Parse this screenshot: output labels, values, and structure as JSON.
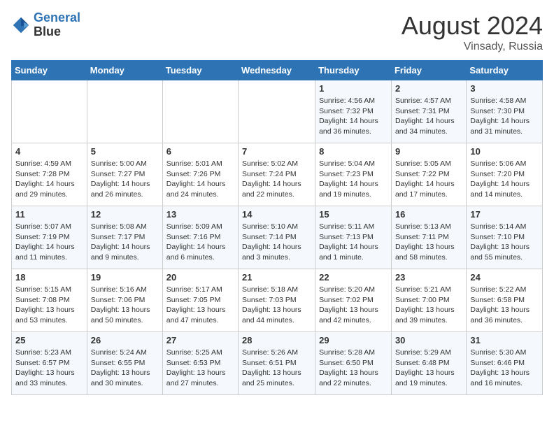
{
  "header": {
    "logo_line1": "General",
    "logo_line2": "Blue",
    "month_title": "August 2024",
    "location": "Vinsady, Russia"
  },
  "weekdays": [
    "Sunday",
    "Monday",
    "Tuesday",
    "Wednesday",
    "Thursday",
    "Friday",
    "Saturday"
  ],
  "weeks": [
    [
      {
        "day": "",
        "info": ""
      },
      {
        "day": "",
        "info": ""
      },
      {
        "day": "",
        "info": ""
      },
      {
        "day": "",
        "info": ""
      },
      {
        "day": "1",
        "info": "Sunrise: 4:56 AM\nSunset: 7:32 PM\nDaylight: 14 hours\nand 36 minutes."
      },
      {
        "day": "2",
        "info": "Sunrise: 4:57 AM\nSunset: 7:31 PM\nDaylight: 14 hours\nand 34 minutes."
      },
      {
        "day": "3",
        "info": "Sunrise: 4:58 AM\nSunset: 7:30 PM\nDaylight: 14 hours\nand 31 minutes."
      }
    ],
    [
      {
        "day": "4",
        "info": "Sunrise: 4:59 AM\nSunset: 7:28 PM\nDaylight: 14 hours\nand 29 minutes."
      },
      {
        "day": "5",
        "info": "Sunrise: 5:00 AM\nSunset: 7:27 PM\nDaylight: 14 hours\nand 26 minutes."
      },
      {
        "day": "6",
        "info": "Sunrise: 5:01 AM\nSunset: 7:26 PM\nDaylight: 14 hours\nand 24 minutes."
      },
      {
        "day": "7",
        "info": "Sunrise: 5:02 AM\nSunset: 7:24 PM\nDaylight: 14 hours\nand 22 minutes."
      },
      {
        "day": "8",
        "info": "Sunrise: 5:04 AM\nSunset: 7:23 PM\nDaylight: 14 hours\nand 19 minutes."
      },
      {
        "day": "9",
        "info": "Sunrise: 5:05 AM\nSunset: 7:22 PM\nDaylight: 14 hours\nand 17 minutes."
      },
      {
        "day": "10",
        "info": "Sunrise: 5:06 AM\nSunset: 7:20 PM\nDaylight: 14 hours\nand 14 minutes."
      }
    ],
    [
      {
        "day": "11",
        "info": "Sunrise: 5:07 AM\nSunset: 7:19 PM\nDaylight: 14 hours\nand 11 minutes."
      },
      {
        "day": "12",
        "info": "Sunrise: 5:08 AM\nSunset: 7:17 PM\nDaylight: 14 hours\nand 9 minutes."
      },
      {
        "day": "13",
        "info": "Sunrise: 5:09 AM\nSunset: 7:16 PM\nDaylight: 14 hours\nand 6 minutes."
      },
      {
        "day": "14",
        "info": "Sunrise: 5:10 AM\nSunset: 7:14 PM\nDaylight: 14 hours\nand 3 minutes."
      },
      {
        "day": "15",
        "info": "Sunrise: 5:11 AM\nSunset: 7:13 PM\nDaylight: 14 hours\nand 1 minute."
      },
      {
        "day": "16",
        "info": "Sunrise: 5:13 AM\nSunset: 7:11 PM\nDaylight: 13 hours\nand 58 minutes."
      },
      {
        "day": "17",
        "info": "Sunrise: 5:14 AM\nSunset: 7:10 PM\nDaylight: 13 hours\nand 55 minutes."
      }
    ],
    [
      {
        "day": "18",
        "info": "Sunrise: 5:15 AM\nSunset: 7:08 PM\nDaylight: 13 hours\nand 53 minutes."
      },
      {
        "day": "19",
        "info": "Sunrise: 5:16 AM\nSunset: 7:06 PM\nDaylight: 13 hours\nand 50 minutes."
      },
      {
        "day": "20",
        "info": "Sunrise: 5:17 AM\nSunset: 7:05 PM\nDaylight: 13 hours\nand 47 minutes."
      },
      {
        "day": "21",
        "info": "Sunrise: 5:18 AM\nSunset: 7:03 PM\nDaylight: 13 hours\nand 44 minutes."
      },
      {
        "day": "22",
        "info": "Sunrise: 5:20 AM\nSunset: 7:02 PM\nDaylight: 13 hours\nand 42 minutes."
      },
      {
        "day": "23",
        "info": "Sunrise: 5:21 AM\nSunset: 7:00 PM\nDaylight: 13 hours\nand 39 minutes."
      },
      {
        "day": "24",
        "info": "Sunrise: 5:22 AM\nSunset: 6:58 PM\nDaylight: 13 hours\nand 36 minutes."
      }
    ],
    [
      {
        "day": "25",
        "info": "Sunrise: 5:23 AM\nSunset: 6:57 PM\nDaylight: 13 hours\nand 33 minutes."
      },
      {
        "day": "26",
        "info": "Sunrise: 5:24 AM\nSunset: 6:55 PM\nDaylight: 13 hours\nand 30 minutes."
      },
      {
        "day": "27",
        "info": "Sunrise: 5:25 AM\nSunset: 6:53 PM\nDaylight: 13 hours\nand 27 minutes."
      },
      {
        "day": "28",
        "info": "Sunrise: 5:26 AM\nSunset: 6:51 PM\nDaylight: 13 hours\nand 25 minutes."
      },
      {
        "day": "29",
        "info": "Sunrise: 5:28 AM\nSunset: 6:50 PM\nDaylight: 13 hours\nand 22 minutes."
      },
      {
        "day": "30",
        "info": "Sunrise: 5:29 AM\nSunset: 6:48 PM\nDaylight: 13 hours\nand 19 minutes."
      },
      {
        "day": "31",
        "info": "Sunrise: 5:30 AM\nSunset: 6:46 PM\nDaylight: 13 hours\nand 16 minutes."
      }
    ]
  ]
}
